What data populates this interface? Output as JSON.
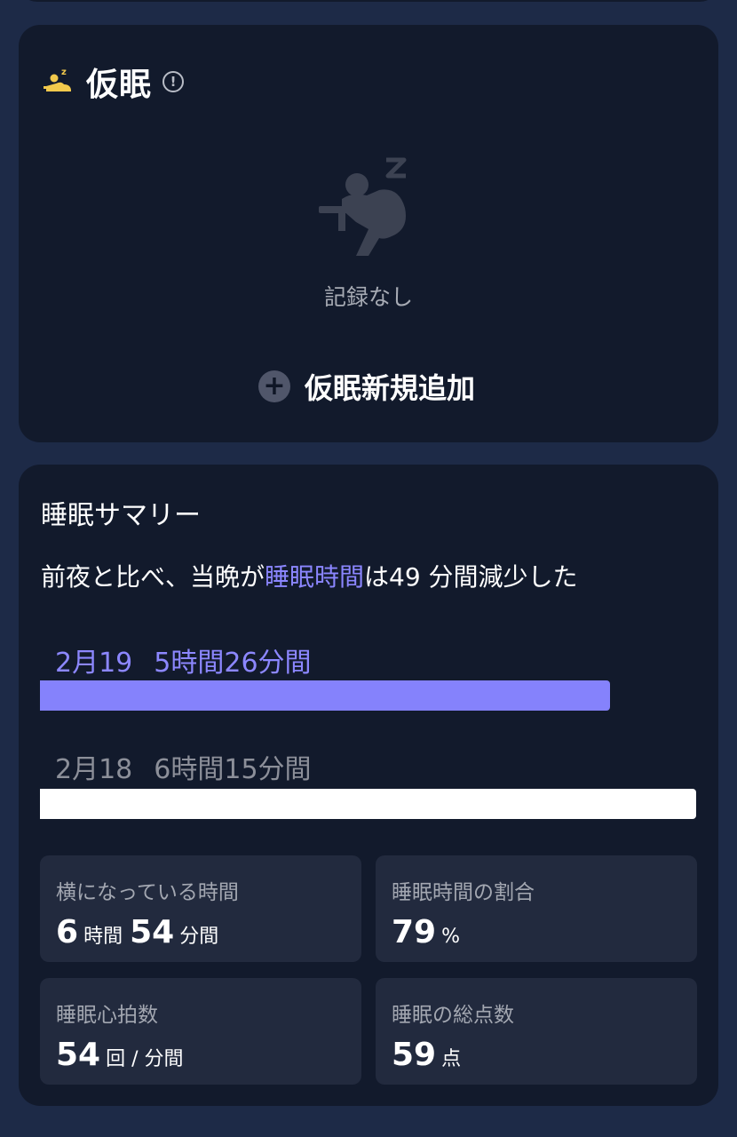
{
  "nap": {
    "title": "仮眠",
    "info_icon": "exclamation-circle-icon",
    "empty_text": "記録なし",
    "add_label": "仮眠新規追加",
    "add_icon": "plus-circle-icon"
  },
  "summary": {
    "title": "睡眠サマリー",
    "sentence_prefix": "前夜と比べ、当晩が",
    "sentence_highlight": "睡眠時間",
    "sentence_suffix": "は49 分間減少した",
    "days": [
      {
        "date": "2月19",
        "duration": "5時間26分間",
        "fraction": 0.869
      },
      {
        "date": "2月18",
        "duration": "6時間15分間",
        "fraction": 1.0
      }
    ],
    "metrics": {
      "lying": {
        "label": "横になっている時間",
        "hours": "6",
        "hours_unit": "時間",
        "minutes": "54",
        "minutes_unit": "分間"
      },
      "ratio": {
        "label": "睡眠時間の割合",
        "value": "79",
        "unit": "%"
      },
      "heart_rate": {
        "label": "睡眠心拍数",
        "value": "54",
        "unit": "回 / 分間"
      },
      "score": {
        "label": "睡眠の総点数",
        "value": "59",
        "unit": "点"
      }
    }
  },
  "colors": {
    "accent": "#8582fc",
    "card_bg": "#121a2c",
    "page_bg": "#1d2a47",
    "metric_bg": "#222a3e"
  }
}
